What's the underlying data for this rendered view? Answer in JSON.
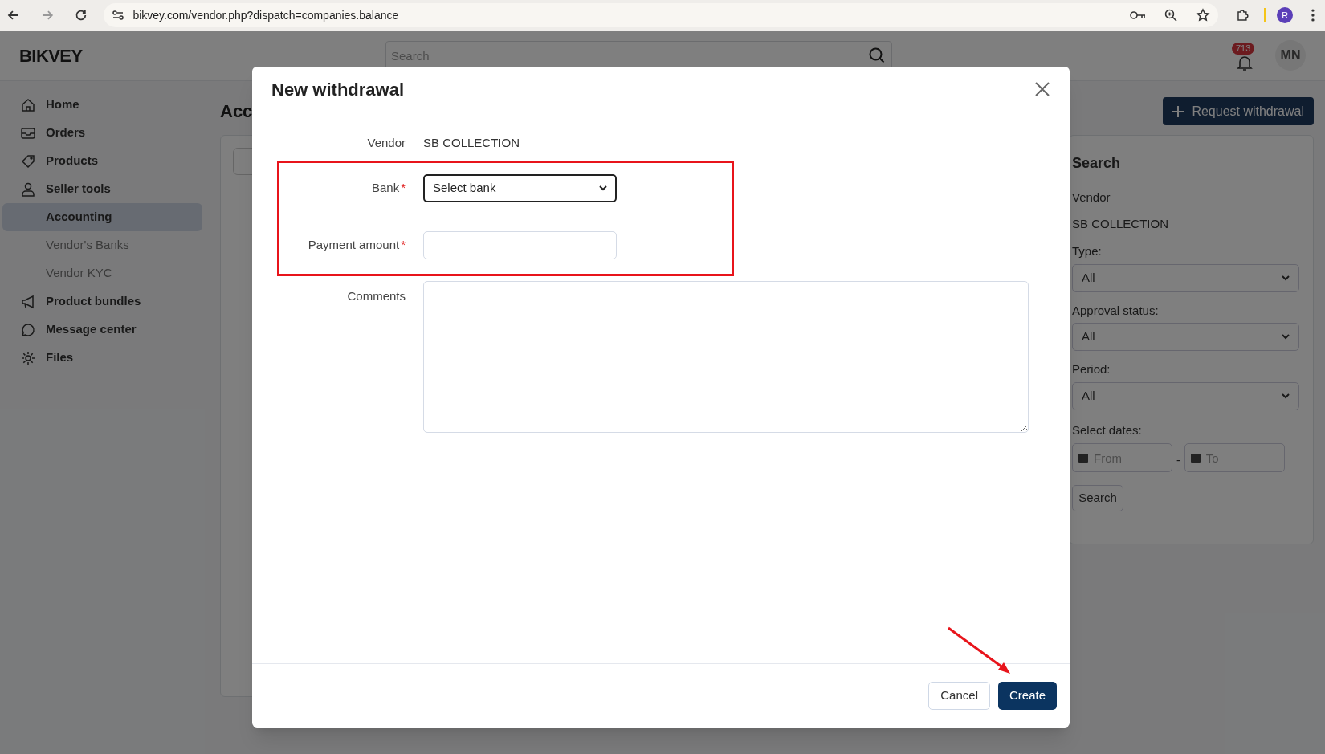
{
  "browser": {
    "url": "bikvey.com/vendor.php?dispatch=companies.balance",
    "profile_initial": "R"
  },
  "header": {
    "logo": "BIKVEY",
    "search_placeholder": "Search",
    "notification_count": "713",
    "avatar": "MN"
  },
  "sidebar": {
    "items": [
      {
        "label": "Home",
        "selected": false
      },
      {
        "label": "Orders",
        "selected": false
      },
      {
        "label": "Products",
        "selected": false
      },
      {
        "label": "Seller tools",
        "selected": false,
        "children": [
          {
            "label": "Accounting",
            "selected": true
          },
          {
            "label": "Vendor's Banks",
            "selected": false
          },
          {
            "label": "Vendor KYC",
            "selected": false
          }
        ]
      },
      {
        "label": "Product bundles",
        "selected": false
      },
      {
        "label": "Message center",
        "selected": false
      },
      {
        "label": "Files",
        "selected": false
      }
    ]
  },
  "page": {
    "heading": "Acc",
    "request_button": "Request withdrawal"
  },
  "search_panel": {
    "title": "Search",
    "vendor_label": "Vendor",
    "vendor_value": "SB COLLECTION",
    "filters": [
      {
        "label": "Type:",
        "value": "All"
      },
      {
        "label": "Approval status:",
        "value": "All"
      },
      {
        "label": "Period:",
        "value": "All"
      }
    ],
    "dates_label": "Select dates:",
    "from_placeholder": "From",
    "separator": "-",
    "to_placeholder": "To",
    "button": "Search"
  },
  "modal": {
    "title": "New withdrawal",
    "fields": [
      {
        "kind": "text",
        "label": "Vendor",
        "value": "SB COLLECTION",
        "highlighted": false
      },
      {
        "kind": "select",
        "label": "Bank",
        "required_mark": "*",
        "value": "Select bank",
        "focused": true,
        "highlighted": true
      },
      {
        "kind": "input",
        "label": "Payment amount",
        "required_mark": "*",
        "focused": false,
        "highlighted": true
      },
      {
        "kind": "textarea",
        "label": "Comments",
        "focused": false,
        "highlighted": false
      }
    ],
    "buttons": [
      {
        "label": "Cancel",
        "primary": false
      },
      {
        "label": "Create",
        "primary": true,
        "pointed": true
      }
    ]
  }
}
